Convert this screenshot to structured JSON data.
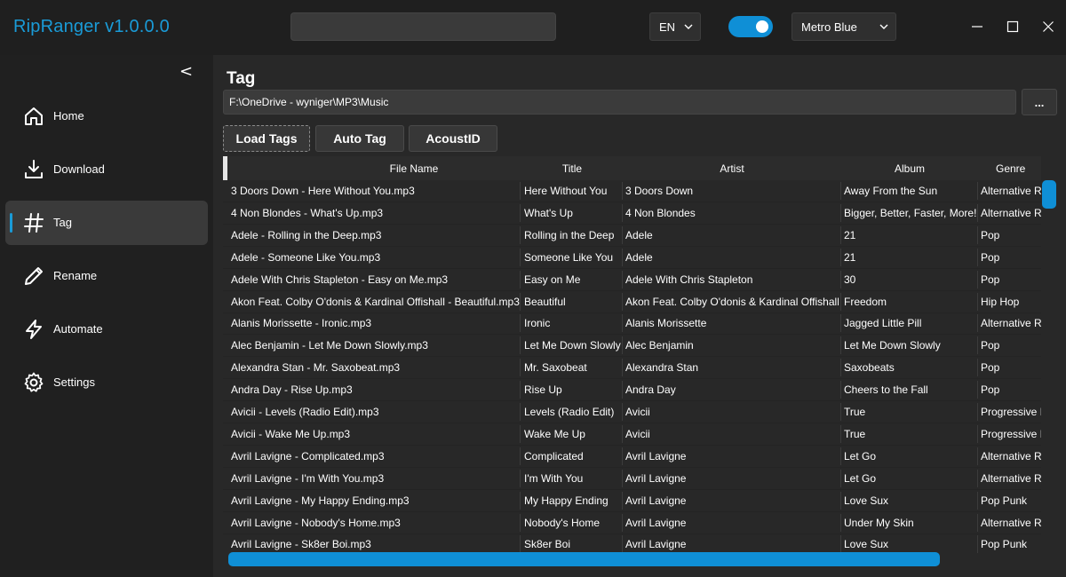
{
  "app": {
    "title": "RipRanger v1.0.0.0",
    "search_value": "",
    "language": "EN",
    "dark_mode_on": true,
    "theme": "Metro Blue",
    "accent_color": "#0f8fd6"
  },
  "sidebar": {
    "collapse_label": "<",
    "items": [
      {
        "label": "Home",
        "icon": "home-icon"
      },
      {
        "label": "Download",
        "icon": "download-icon"
      },
      {
        "label": "Tag",
        "icon": "hash-icon",
        "active": true
      },
      {
        "label": "Rename",
        "icon": "pencil-icon"
      },
      {
        "label": "Automate",
        "icon": "lightning-icon"
      },
      {
        "label": "Settings",
        "icon": "gear-icon"
      }
    ]
  },
  "main": {
    "title": "Tag",
    "path": "F:\\OneDrive - wyniger\\MP3\\Music",
    "browse_label": "...",
    "buttons": {
      "load_tags": "Load Tags",
      "auto_tag": "Auto Tag",
      "acoustid": "AcoustID"
    },
    "table": {
      "columns": [
        "File Name",
        "Title",
        "Artist",
        "Album",
        "Genre"
      ],
      "rows": [
        [
          "3 Doors Down - Here Without You.mp3",
          "Here Without You",
          "3 Doors Down",
          "Away From the Sun",
          "Alternative Rock"
        ],
        [
          "4 Non Blondes - What's Up.mp3",
          "What's Up",
          "4 Non Blondes",
          "Bigger, Better, Faster, More!",
          "Alternative Rock"
        ],
        [
          "Adele - Rolling in the Deep.mp3",
          "Rolling in the Deep",
          "Adele",
          "21",
          "Pop"
        ],
        [
          "Adele - Someone Like You.mp3",
          "Someone Like You",
          "Adele",
          "21",
          "Pop"
        ],
        [
          "Adele With Chris Stapleton - Easy on Me.mp3",
          "Easy on Me",
          "Adele With Chris Stapleton",
          "30",
          "Pop"
        ],
        [
          "Akon Feat. Colby O'donis & Kardinal Offishall - Beautiful.mp3",
          "Beautiful",
          "Akon Feat. Colby O'donis & Kardinal Offishall",
          "Freedom",
          "Hip Hop"
        ],
        [
          "Alanis Morissette - Ironic.mp3",
          "Ironic",
          "Alanis Morissette",
          "Jagged Little Pill",
          "Alternative Rock"
        ],
        [
          "Alec Benjamin - Let Me Down Slowly.mp3",
          "Let Me Down Slowly",
          "Alec Benjamin",
          "Let Me Down Slowly",
          "Pop"
        ],
        [
          "Alexandra Stan - Mr. Saxobeat.mp3",
          "Mr. Saxobeat",
          "Alexandra Stan",
          "Saxobeats",
          "Pop"
        ],
        [
          "Andra Day - Rise Up.mp3",
          "Rise Up",
          "Andra Day",
          "Cheers to the Fall",
          "Pop"
        ],
        [
          "Avicii - Levels (Radio Edit).mp3",
          "Levels (Radio Edit)",
          "Avicii",
          "True",
          "Progressive House"
        ],
        [
          "Avicii - Wake Me Up.mp3",
          "Wake Me Up",
          "Avicii",
          "True",
          "Progressive House"
        ],
        [
          "Avril Lavigne - Complicated.mp3",
          "Complicated",
          "Avril Lavigne",
          "Let Go",
          "Alternative Rock"
        ],
        [
          "Avril Lavigne - I'm With You.mp3",
          "I'm With You",
          "Avril Lavigne",
          "Let Go",
          "Alternative Rock"
        ],
        [
          "Avril Lavigne - My Happy Ending.mp3",
          "My Happy Ending",
          "Avril Lavigne",
          "Love Sux",
          "Pop Punk"
        ],
        [
          "Avril Lavigne - Nobody's Home.mp3",
          "Nobody's Home",
          "Avril Lavigne",
          "Under My Skin",
          "Alternative Rock"
        ],
        [
          "Avril Lavigne - Sk8er Boi.mp3",
          "Sk8er Boi",
          "Avril Lavigne",
          "Love Sux",
          "Pop Punk"
        ]
      ]
    }
  }
}
